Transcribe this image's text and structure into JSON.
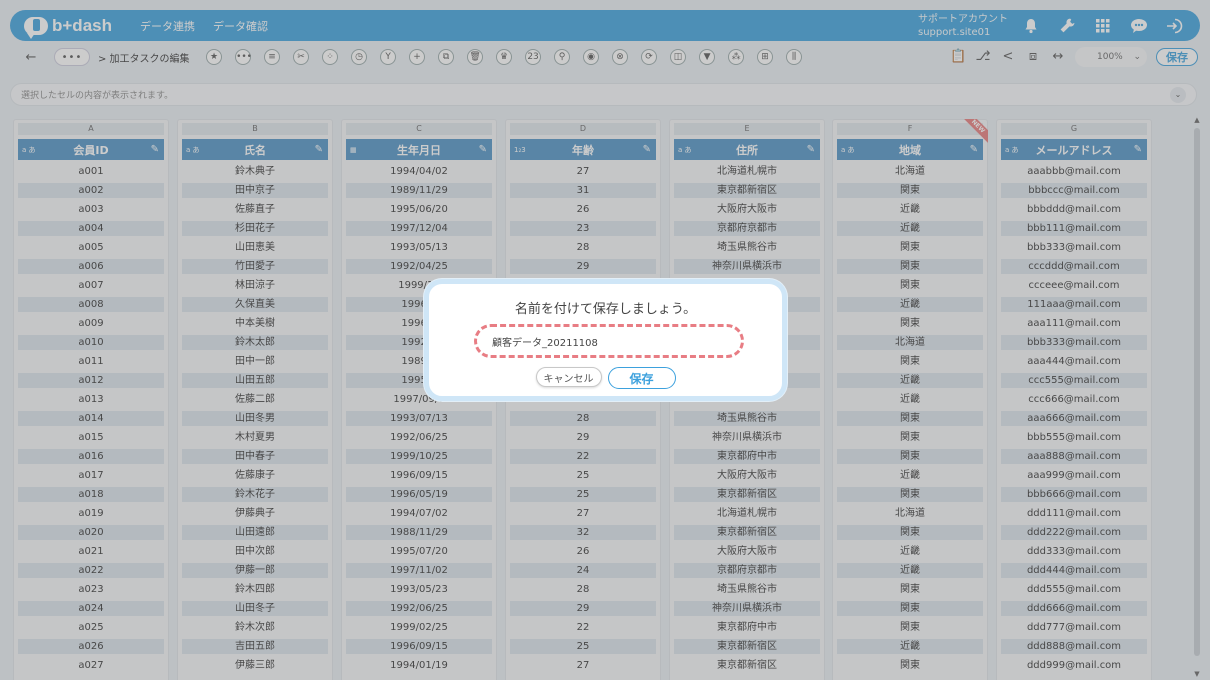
{
  "header": {
    "logo_text": "b+dash",
    "nav": [
      "データ連携",
      "データ確認"
    ],
    "account_name": "サポートアカウント",
    "account_id": "support.site01",
    "icons": [
      "bell-icon",
      "wrench-icon",
      "grid-icon",
      "chat-icon",
      "logout-icon"
    ]
  },
  "toolbar": {
    "back_label": "←",
    "more_label": "•••",
    "breadcrumb": "> 加工タスクの編集",
    "tools": [
      "★",
      "•••",
      "≡",
      "✂",
      "⁘",
      "◷",
      "Y",
      "+",
      "⧉",
      "🗑",
      "♛",
      "23",
      "⚲",
      "◉",
      "⊗",
      "⟳",
      "◫",
      "▼",
      "⁂",
      "⊞",
      "⫼"
    ],
    "right_icons": [
      "📋",
      "⎇",
      "<",
      "⧈",
      "↔"
    ],
    "zoom": "100%",
    "zoom_caret": "⌄",
    "save_label": "保存"
  },
  "cellbar": {
    "placeholder": "選択したセルの内容が表示されます。",
    "chevron": "⌄"
  },
  "new_badge": "NEW",
  "columns": [
    {
      "letter": "A",
      "type": "a あ",
      "name": "会員ID",
      "cells": [
        "a001",
        "a002",
        "a003",
        "a004",
        "a005",
        "a006",
        "a007",
        "a008",
        "a009",
        "a010",
        "a011",
        "a012",
        "a013",
        "a014",
        "a015",
        "a016",
        "a017",
        "a018",
        "a019",
        "a020",
        "a021",
        "a022",
        "a023",
        "a024",
        "a025",
        "a026",
        "a027"
      ]
    },
    {
      "letter": "B",
      "type": "a あ",
      "name": "氏名",
      "cells": [
        "鈴木典子",
        "田中京子",
        "佐藤直子",
        "杉田花子",
        "山田恵美",
        "竹田愛子",
        "林田涼子",
        "久保直美",
        "中本美樹",
        "鈴木太郎",
        "田中一郎",
        "山田五郎",
        "佐藤二郎",
        "山田冬男",
        "木村夏男",
        "田中春子",
        "佐藤康子",
        "鈴木花子",
        "伊藤典子",
        "山田遠郎",
        "田中次郎",
        "伊藤一郎",
        "鈴木四郎",
        "山田冬子",
        "鈴木次郎",
        "吉田五郎",
        "伊藤三郎"
      ]
    },
    {
      "letter": "C",
      "type": "▦",
      "name": "生年月日",
      "cells": [
        "1994/04/02",
        "1989/11/29",
        "1995/06/20",
        "1997/12/04",
        "1993/05/13",
        "1992/04/25",
        "1999/12",
        "1996/0",
        "1996/0",
        "1992/0",
        "1989/0",
        "1995/0",
        "1997/09/0",
        "1993/07/13",
        "1992/06/25",
        "1999/10/25",
        "1996/09/15",
        "1996/05/19",
        "1994/07/02",
        "1988/11/29",
        "1995/07/20",
        "1997/11/02",
        "1993/05/23",
        "1992/06/25",
        "1999/02/25",
        "1996/09/15",
        "1994/01/19"
      ]
    },
    {
      "letter": "D",
      "type": "1₂3",
      "name": "年齢",
      "cells": [
        "27",
        "31",
        "26",
        "23",
        "28",
        "29",
        "",
        "",
        "",
        "",
        "",
        "",
        "",
        "28",
        "29",
        "22",
        "25",
        "25",
        "27",
        "32",
        "26",
        "24",
        "28",
        "29",
        "22",
        "25",
        "27"
      ]
    },
    {
      "letter": "E",
      "type": "a あ",
      "name": "住所",
      "cells": [
        "北海道札幌市",
        "東京都新宿区",
        "大阪府大阪市",
        "京都府京都市",
        "埼玉県熊谷市",
        "神奈川県横浜市",
        "",
        "",
        "",
        "",
        "",
        "",
        "",
        "埼玉県熊谷市",
        "神奈川県横浜市",
        "東京都府中市",
        "大阪府大阪市",
        "東京都新宿区",
        "北海道札幌市",
        "東京都新宿区",
        "大阪府大阪市",
        "京都府京都市",
        "埼玉県熊谷市",
        "神奈川県横浜市",
        "東京都府中市",
        "東京都新宿区",
        "東京都新宿区"
      ]
    },
    {
      "letter": "F",
      "type": "a あ",
      "name": "地域",
      "cells": [
        "北海道",
        "関東",
        "近畿",
        "近畿",
        "関東",
        "関東",
        "関東",
        "近畿",
        "関東",
        "北海道",
        "関東",
        "近畿",
        "近畿",
        "関東",
        "関東",
        "関東",
        "近畿",
        "関東",
        "北海道",
        "関東",
        "近畿",
        "近畿",
        "関東",
        "関東",
        "関東",
        "近畿",
        "関東"
      ]
    },
    {
      "letter": "G",
      "type": "a あ",
      "name": "メールアドレス",
      "cells": [
        "aaabbb@mail.com",
        "bbbccc@mail.com",
        "bbbddd@mail.com",
        "bbb111@mail.com",
        "bbb333@mail.com",
        "cccddd@mail.com",
        "ccceee@mail.com",
        "111aaa@mail.com",
        "aaa111@mail.com",
        "bbb333@mail.com",
        "aaa444@mail.com",
        "ccc555@mail.com",
        "ccc666@mail.com",
        "aaa666@mail.com",
        "bbb555@mail.com",
        "aaa888@mail.com",
        "aaa999@mail.com",
        "bbb666@mail.com",
        "ddd111@mail.com",
        "ddd222@mail.com",
        "ddd333@mail.com",
        "ddd444@mail.com",
        "ddd555@mail.com",
        "ddd666@mail.com",
        "ddd777@mail.com",
        "ddd888@mail.com",
        "ddd999@mail.com"
      ]
    }
  ],
  "modal": {
    "title": "名前を付けて保存しましょう。",
    "input_value": "顧客データ_20211108",
    "cancel_label": "キャンセル",
    "save_label": "保存"
  },
  "scrollbar": {
    "up": "▲",
    "down": "▼"
  }
}
